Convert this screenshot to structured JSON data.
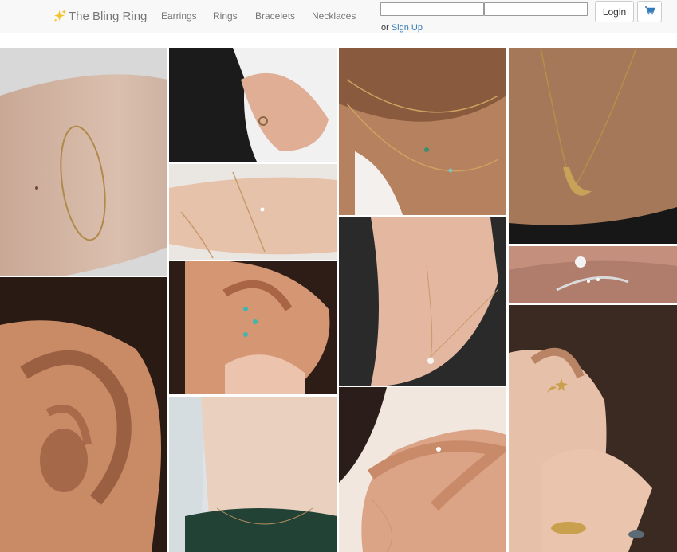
{
  "navbar": {
    "brand": "The Bling Ring",
    "brand_icon": "sparkles-icon",
    "links": [
      "Earrings",
      "Rings",
      "Bracelets",
      "Necklaces"
    ],
    "username_placeholder": "",
    "password_placeholder": "",
    "login_label": "Login",
    "cart_icon": "cart-icon",
    "signup_prefix": "or ",
    "signup_label": "Sign Up"
  },
  "colors": {
    "link_blue": "#337ab7",
    "nav_text": "#777777",
    "navbar_bg": "#f8f8f8",
    "sparkle": "#f4c430"
  },
  "gallery": [
    {
      "subject": "bracelet-on-wrist"
    },
    {
      "subject": "ring-on-hand-black-fabric"
    },
    {
      "subject": "layered-necklaces"
    },
    {
      "subject": "crescent-moon-necklace"
    },
    {
      "subject": "thin-bracelets"
    },
    {
      "subject": "diamond-ring"
    },
    {
      "subject": "ear-stud-earrings"
    },
    {
      "subject": "pendant-necklace"
    },
    {
      "subject": "ear-closeup"
    },
    {
      "subject": "neck-necklace"
    },
    {
      "subject": "rings-on-shoulder-hand"
    },
    {
      "subject": "moon-star-earrings-and-rings"
    }
  ]
}
